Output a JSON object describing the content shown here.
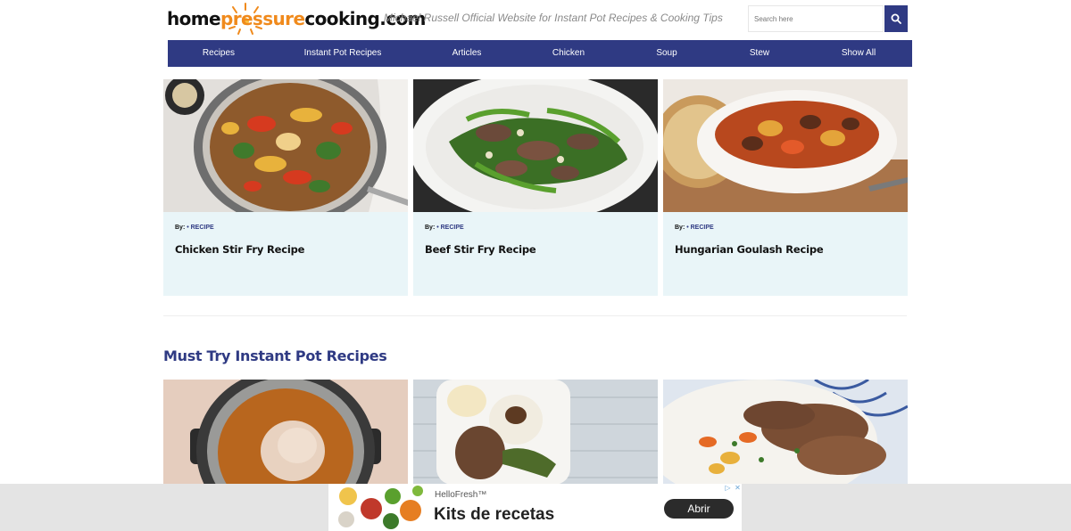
{
  "header": {
    "logo_parts": [
      "home",
      "pressure",
      "cooking",
      ".com"
    ],
    "tagline": "Michael Russell Official Website for Instant Pot Recipes & Cooking Tips",
    "search_placeholder": "Search here"
  },
  "nav": {
    "items": [
      "Recipes",
      "Instant Pot Recipes",
      "Articles",
      "Chicken",
      "Soup",
      "Stew",
      "Show All"
    ]
  },
  "cards": [
    {
      "by": "By:",
      "category": "• RECIPE",
      "title": "Chicken Stir Fry Recipe"
    },
    {
      "by": "By:",
      "category": "• RECIPE",
      "title": "Beef Stir Fry Recipe"
    },
    {
      "by": "By:",
      "category": "• RECIPE",
      "title": "Hungarian Goulash Recipe"
    }
  ],
  "section": {
    "title": "Must Try Instant Pot Recipes"
  },
  "ad": {
    "sponsor": "HelloFresh™",
    "headline": "Kits de recetas",
    "cta": "Abrir"
  },
  "colors": {
    "brand_blue": "#2f3a83",
    "logo_orange": "#f08a1c",
    "card_bg": "#e9f5f8"
  }
}
